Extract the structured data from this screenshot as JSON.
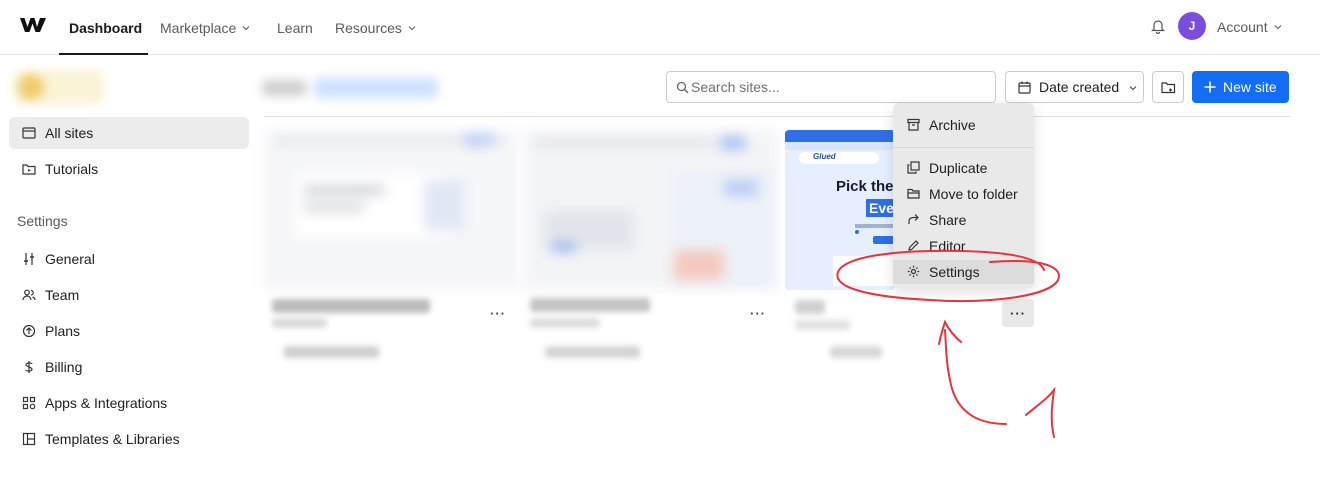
{
  "topnav": {
    "items": [
      {
        "label": "Dashboard"
      },
      {
        "label": "Marketplace"
      },
      {
        "label": "Learn"
      },
      {
        "label": "Resources"
      }
    ],
    "avatar_initial": "J",
    "account_label": "Account"
  },
  "sidebar": {
    "items": [
      {
        "label": "All sites",
        "icon": "browser-icon"
      },
      {
        "label": "Tutorials",
        "icon": "folder-play-icon"
      }
    ],
    "settings_heading": "Settings",
    "settings_items": [
      {
        "label": "General",
        "icon": "sliders-icon"
      },
      {
        "label": "Team",
        "icon": "users-icon"
      },
      {
        "label": "Plans",
        "icon": "plan-icon"
      },
      {
        "label": "Billing",
        "icon": "dollar-icon"
      },
      {
        "label": "Apps & Integrations",
        "icon": "apps-icon"
      },
      {
        "label": "Templates & Libraries",
        "icon": "templates-icon"
      }
    ]
  },
  "toolbar": {
    "search_placeholder": "Search sites...",
    "sort_label": "Date created",
    "new_site_label": "New site"
  },
  "card3": {
    "headline_line1": "Pick the",
    "headline_line2": "Eve",
    "logo_text": "Glued"
  },
  "context_menu": {
    "items": [
      {
        "label": "Archive",
        "icon": "archive-icon"
      },
      {
        "label": "Duplicate",
        "icon": "duplicate-icon"
      },
      {
        "label": "Move to folder",
        "icon": "folder-icon"
      },
      {
        "label": "Share",
        "icon": "share-icon"
      },
      {
        "label": "Editor",
        "icon": "pencil-icon"
      },
      {
        "label": "Settings",
        "icon": "gear-icon"
      }
    ]
  },
  "more_label": "···",
  "colors": {
    "accent": "#146ef5",
    "avatar": "#7c4ddb",
    "annotation": "#e8323c"
  }
}
